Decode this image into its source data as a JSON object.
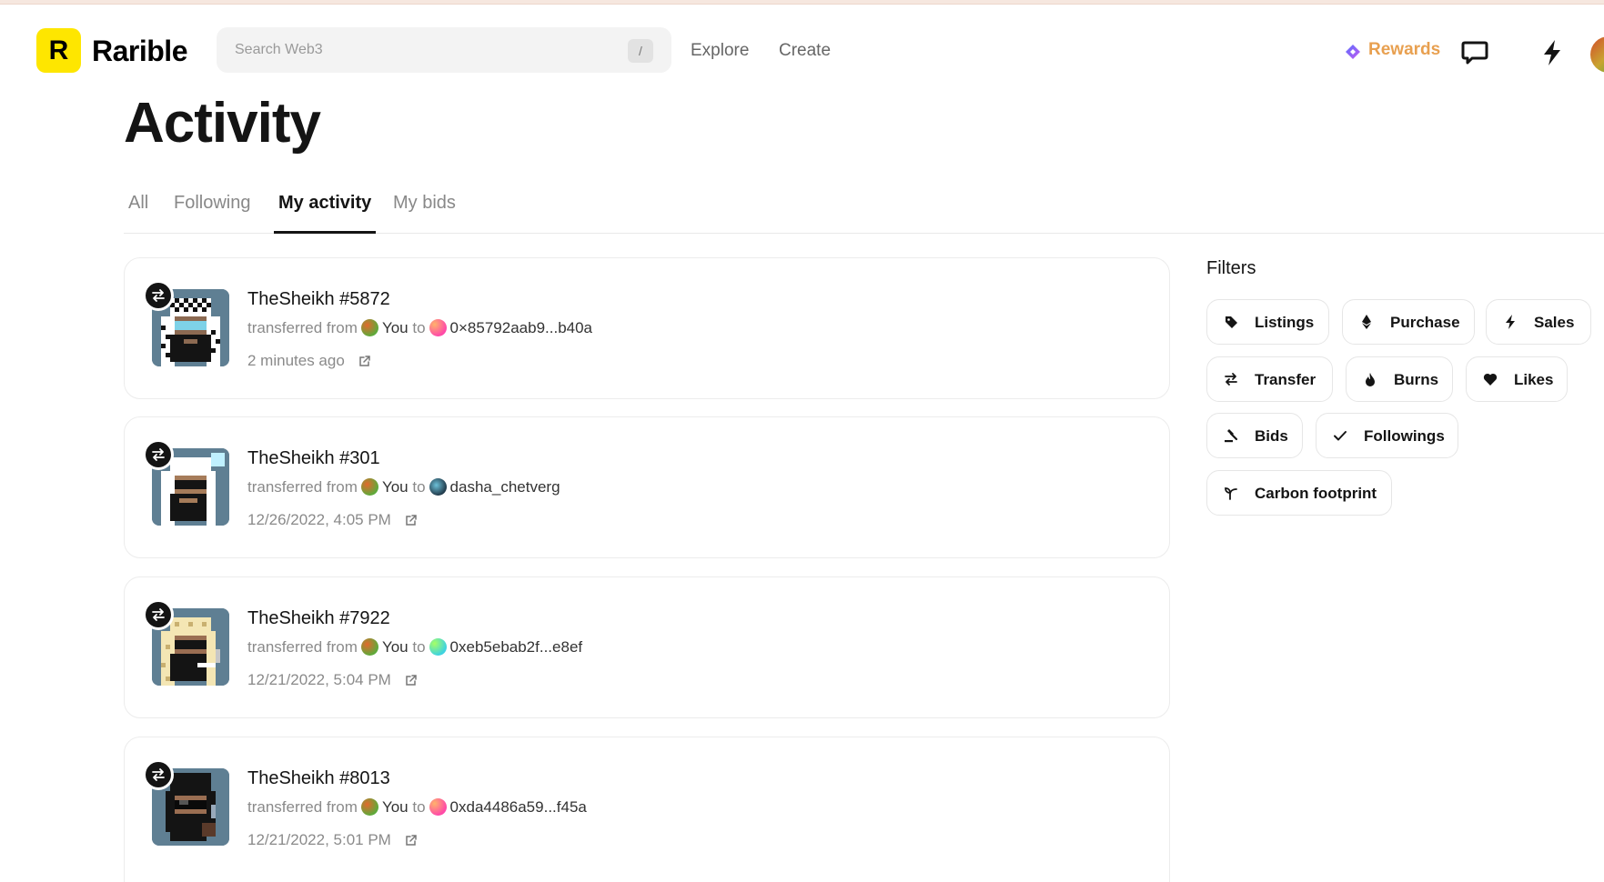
{
  "header": {
    "brand": "Rarible",
    "logo_letter": "R",
    "search_placeholder": "Search Web3",
    "search_shortcut": "/",
    "nav": [
      "Explore",
      "Create"
    ],
    "rewards": "Rewards",
    "colors": {
      "logo": "#fee600",
      "rewards": "#e8a050"
    }
  },
  "page": {
    "title": "Activity",
    "tabs": [
      "All",
      "Following",
      "My activity",
      "My bids"
    ],
    "active_tab": "My activity"
  },
  "activities": [
    {
      "title": "TheSheikh #5872",
      "verb": "transferred from",
      "from": "You",
      "to_word": "to",
      "to": "0×85792aab9...b40a",
      "time": "2 minutes ago"
    },
    {
      "title": "TheSheikh #301",
      "verb": "transferred from",
      "from": "You",
      "to_word": "to",
      "to": "dasha_chetverg",
      "time": "12/26/2022, 4:05 PM"
    },
    {
      "title": "TheSheikh #7922",
      "verb": "transferred from",
      "from": "You",
      "to_word": "to",
      "to": "0xeb5ebab2f...e8ef",
      "time": "12/21/2022, 5:04 PM"
    },
    {
      "title": "TheSheikh #8013",
      "verb": "transferred from",
      "from": "You",
      "to_word": "to",
      "to": "0xda4486a59...f45a",
      "time": "12/21/2022, 5:01 PM"
    }
  ],
  "filters": {
    "title": "Filters",
    "items": [
      "Listings",
      "Purchase",
      "Sales",
      "Transfer",
      "Burns",
      "Likes",
      "Bids",
      "Followings",
      "Carbon footprint"
    ]
  }
}
